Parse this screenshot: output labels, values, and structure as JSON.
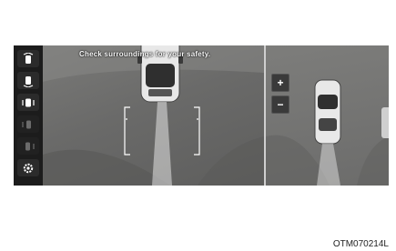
{
  "screen": {
    "warning_text": "Check surroundings for your safety.",
    "sidebar": {
      "items": [
        {
          "icon": "front-view-icon",
          "state": "active"
        },
        {
          "icon": "rear-view-icon",
          "state": "normal"
        },
        {
          "icon": "side-view-icon",
          "state": "normal"
        },
        {
          "icon": "left-view-icon",
          "state": "disabled"
        },
        {
          "icon": "right-view-icon",
          "state": "disabled"
        },
        {
          "icon": "gear-icon",
          "state": "normal"
        }
      ]
    },
    "zoom": {
      "in_label": "+",
      "out_label": "−"
    }
  },
  "figure_code": "OTM070214L",
  "colors": {
    "bezel": "#1c1c1c",
    "ground": "#6e6e6d",
    "divider": "#cfcfcf",
    "guide": "#ffffff"
  }
}
